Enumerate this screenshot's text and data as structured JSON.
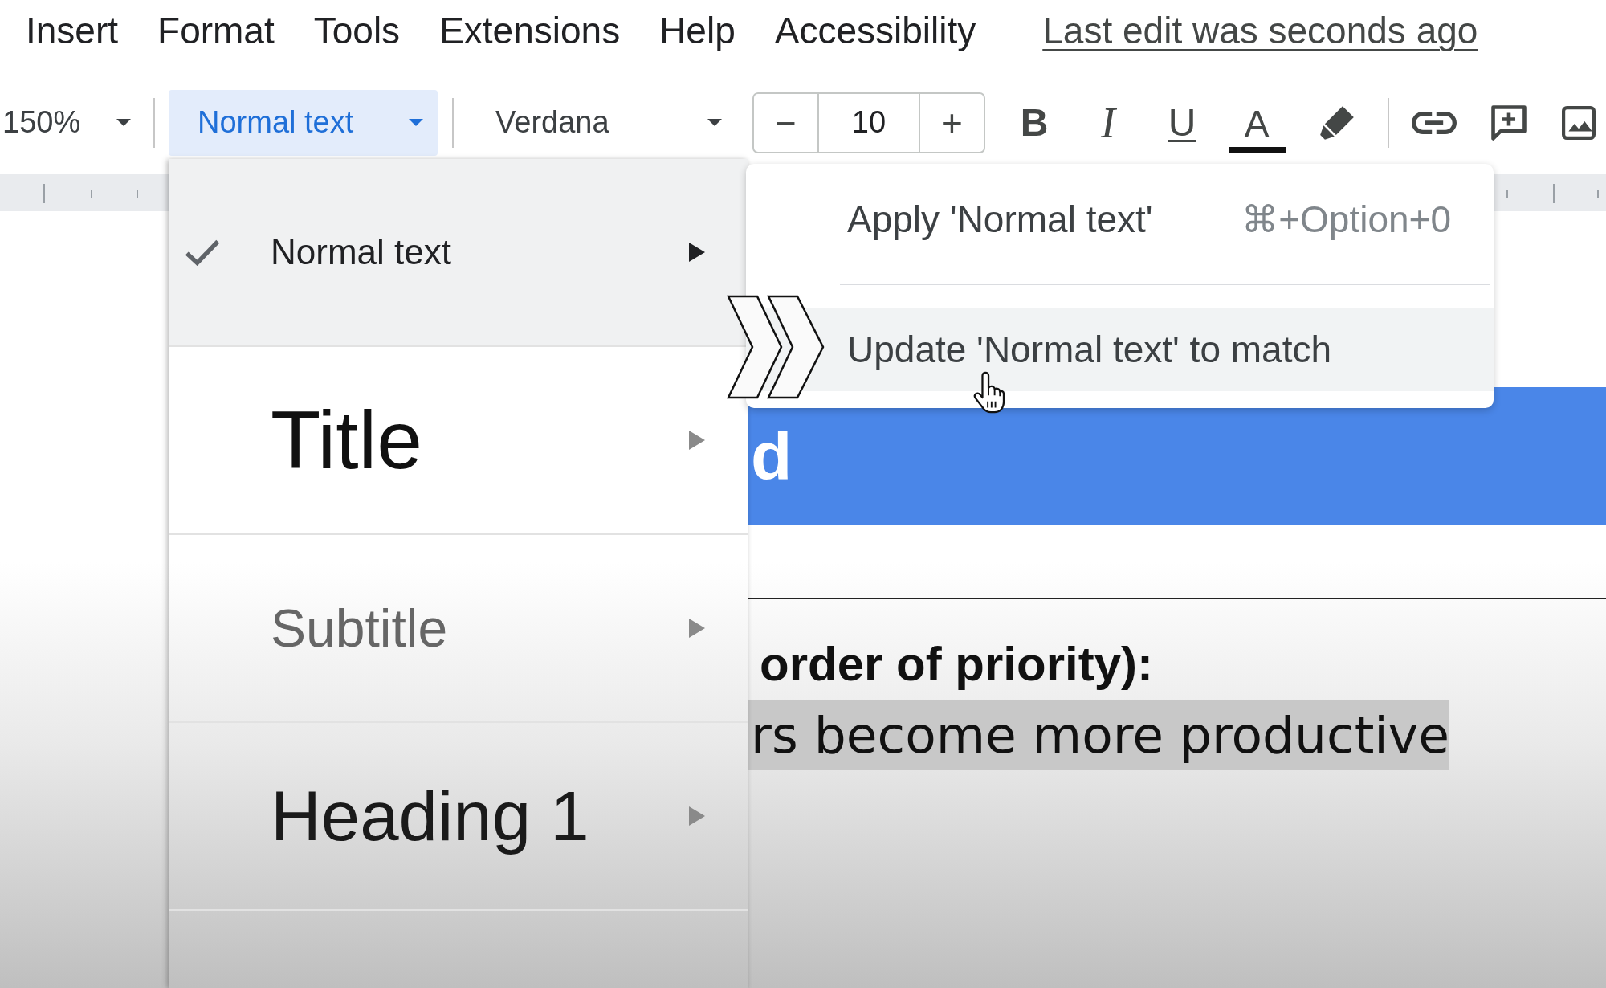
{
  "menu_bar": {
    "items": [
      "Insert",
      "Format",
      "Tools",
      "Extensions",
      "Help",
      "Accessibility"
    ],
    "last_edit": "Last edit was seconds ago"
  },
  "toolbar": {
    "zoom": "150%",
    "paragraph_style": {
      "label": "Normal text",
      "expanded": true
    },
    "font": "Verdana",
    "font_size": {
      "decrease": "−",
      "value": "10",
      "increase": "+"
    },
    "format_buttons": [
      {
        "kind": "bold",
        "label": "B"
      },
      {
        "kind": "italic",
        "label": "I"
      },
      {
        "kind": "underline",
        "label": "U"
      },
      {
        "kind": "text_color",
        "label": "A"
      }
    ]
  },
  "style_menu": {
    "items": [
      {
        "kind": "normal",
        "label": "Normal text",
        "checked": true,
        "expanded": true
      },
      {
        "kind": "title",
        "label": "Title",
        "checked": false,
        "expanded": false
      },
      {
        "kind": "subtitle",
        "label": "Subtitle",
        "checked": false,
        "expanded": false
      },
      {
        "kind": "heading_1",
        "label": "Heading 1",
        "checked": false,
        "expanded": false
      }
    ]
  },
  "submenu": {
    "items": [
      {
        "label": "Apply 'Normal text'",
        "shortcut": "⌘+Option+0",
        "selected": false
      },
      {
        "label": "Update 'Normal text' to match",
        "selected": true
      }
    ]
  },
  "document": {
    "banner": "d",
    "paragraphs": [
      {
        "kind": "bold",
        "text": "order of priority):",
        "highlighted": false
      },
      {
        "kind": "plain",
        "text": "rs become more productive",
        "highlighted": true
      }
    ]
  }
}
